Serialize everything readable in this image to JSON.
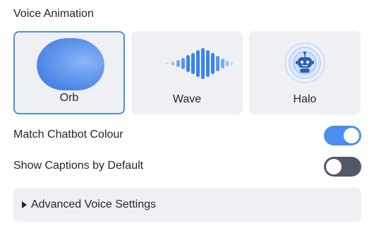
{
  "voice_animation": {
    "title": "Voice Animation",
    "selected": "Orb",
    "options": [
      {
        "label": "Orb",
        "icon": "orb-icon"
      },
      {
        "label": "Wave",
        "icon": "wave-icon"
      },
      {
        "label": "Halo",
        "icon": "chatbot-halo-icon"
      }
    ]
  },
  "settings": {
    "match_colour": {
      "label": "Match Chatbot Colour",
      "enabled": true
    },
    "show_captions": {
      "label": "Show Captions by Default",
      "enabled": false
    }
  },
  "advanced": {
    "label": "Advanced Voice Settings",
    "expanded": false
  },
  "colors": {
    "accent": "#4a8ff0",
    "selected_border": "#4a90e2",
    "toggle_off": "#525866",
    "card_bg": "#eef0f4"
  }
}
